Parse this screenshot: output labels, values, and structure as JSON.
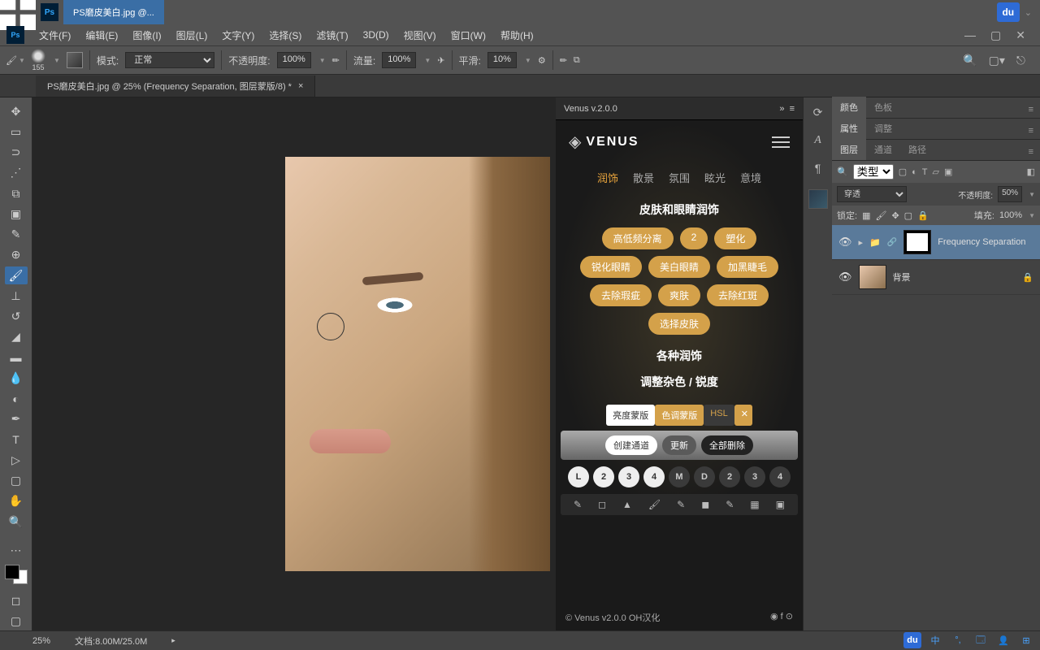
{
  "titlebar": {
    "filename": "PS磨皮美白.jpg @...",
    "du": "du"
  },
  "menu": {
    "file": "文件(F)",
    "edit": "编辑(E)",
    "image": "图像(I)",
    "layer": "图层(L)",
    "type": "文字(Y)",
    "select": "选择(S)",
    "filter": "滤镜(T)",
    "threeD": "3D(D)",
    "view": "视图(V)",
    "window": "窗口(W)",
    "help": "帮助(H)"
  },
  "options": {
    "size_num": "155",
    "mode_label": "模式:",
    "mode_val": "正常",
    "opacity_label": "不透明度:",
    "opacity_val": "100%",
    "flow_label": "流量:",
    "flow_val": "100%",
    "smooth_label": "平滑:",
    "smooth_val": "10%"
  },
  "doctab": {
    "title": "PS磨皮美白.jpg @ 25% (Frequency Separation, 图层蒙版/8) *"
  },
  "venus": {
    "title": "Venus v.2.0.0",
    "logo": "VENUS",
    "tabs": {
      "t1": "润饰",
      "t2": "散景",
      "t3": "氛围",
      "t4": "眩光",
      "t5": "意境"
    },
    "section1": "皮肤和眼睛润饰",
    "row1": {
      "a": "高低频分离",
      "b": "2",
      "c": "塑化"
    },
    "row2": {
      "a": "锐化眼睛",
      "b": "美白眼睛",
      "c": "加黑睫毛"
    },
    "row3": {
      "a": "去除瑕疵",
      "b": "爽肤",
      "c": "去除红斑"
    },
    "row4": {
      "a": "选择皮肤"
    },
    "section2": "各种润饰",
    "section3": "调整杂色 / 锐度",
    "mtabs": {
      "a": "亮度蒙版",
      "b": "色调蒙版",
      "c": "HSL",
      "x": "✕"
    },
    "actions": {
      "a": "创建通道",
      "b": "更新",
      "c": "全部删除"
    },
    "nums": {
      "n1": "L",
      "n2": "2",
      "n3": "3",
      "n4": "4",
      "n5": "M",
      "n6": "D",
      "n7": "2",
      "n8": "3",
      "n9": "4"
    },
    "footer_l": "© Venus v2.0.0  OH汉化",
    "footer_r": "◉ f ⊙"
  },
  "panels": {
    "color": "颜色",
    "swatches": "色板",
    "props": "属性",
    "adjust": "调整",
    "layers": "图层",
    "channels": "通道",
    "paths": "路径",
    "kind_label": "类型",
    "blend": "穿透",
    "opacity_lbl": "不透明度:",
    "opacity_v": "50%",
    "lock_lbl": "锁定:",
    "fill_lbl": "填充:",
    "fill_v": "100%",
    "layer1": "Frequency Separation",
    "layer2": "背景"
  },
  "status": {
    "zoom": "25%",
    "doc": "文档:8.00M/25.0M"
  },
  "tb": {
    "cn": "中"
  }
}
